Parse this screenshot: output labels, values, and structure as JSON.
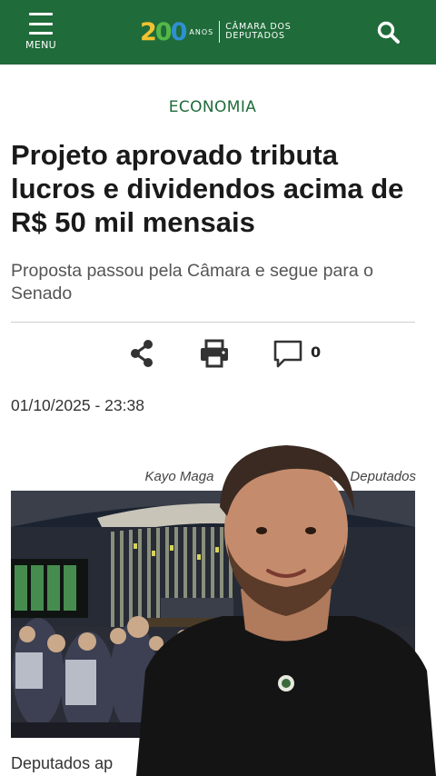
{
  "header": {
    "menu_label": "MENU",
    "logo": {
      "year_digits": [
        "2",
        "0",
        "0"
      ],
      "anos": "ANOS",
      "line1": "CÂMARA DOS",
      "line2": "DEPUTADOS"
    },
    "menu_icon": "hamburger-icon",
    "search_icon": "search-icon",
    "colors": {
      "bar": "#1f6b3a",
      "accent_yellow": "#f2c230",
      "accent_green": "#53b848",
      "accent_blue": "#2f8fd0"
    }
  },
  "article": {
    "section": "ECONOMIA",
    "headline": "Projeto aprovado tributa lucros e dividendos acima de R$ 50 mil mensais",
    "subtitle": "Proposta passou pela Câmara e segue para o Senado",
    "actions": {
      "share_icon": "share-icon",
      "print_icon": "print-icon",
      "comment_icon": "comment-icon",
      "comment_count": "0"
    },
    "date": "01/10/2025 - 23:38",
    "photo_credit": "Kayo Maga",
    "photo_credit_tail": "os Deputados",
    "caption": "Deputados ap"
  }
}
